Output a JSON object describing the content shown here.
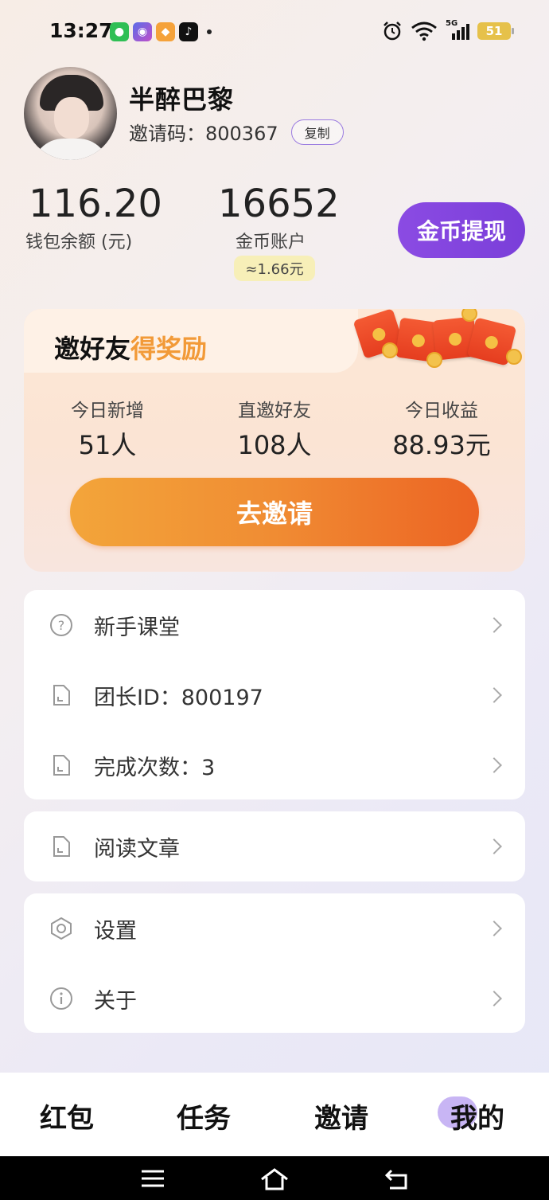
{
  "status_bar": {
    "time": "13:27",
    "battery": "51",
    "network": "5G"
  },
  "profile": {
    "username": "半醉巴黎",
    "invite_code": "邀请码：800367",
    "copy_label": "复制"
  },
  "wallet": {
    "balance_value": "116.20",
    "balance_label": "钱包余额 (元)",
    "coins_value": "16652",
    "coins_label": "金币账户",
    "coins_approx": "≈1.66元",
    "withdraw_label": "金币提现"
  },
  "invite_card": {
    "title_main": "邀好友",
    "title_highlight": "得奖励",
    "stats": [
      {
        "label": "今日新增",
        "value": "51人"
      },
      {
        "label": "直邀好友",
        "value": "108人"
      },
      {
        "label": "今日收益",
        "value": "88.93元"
      }
    ],
    "button_label": "去邀请"
  },
  "menu_group_1": [
    {
      "label": "新手课堂",
      "icon": "help-circle-icon"
    },
    {
      "label": "团长ID：800197",
      "icon": "document-icon"
    },
    {
      "label": "完成次数：3",
      "icon": "document-icon"
    }
  ],
  "menu_group_2": [
    {
      "label": "阅读文章",
      "icon": "document-icon"
    }
  ],
  "menu_group_3": [
    {
      "label": "设置",
      "icon": "settings-hexagon-icon"
    },
    {
      "label": "关于",
      "icon": "info-icon"
    }
  ],
  "bottom_nav": {
    "items": [
      "红包",
      "任务",
      "邀请",
      "我的"
    ],
    "active": "我的"
  },
  "colors": {
    "accent_purple": "#7a3ed9",
    "invite_orange": "#ec6323",
    "highlight_orange": "#f29a38"
  }
}
